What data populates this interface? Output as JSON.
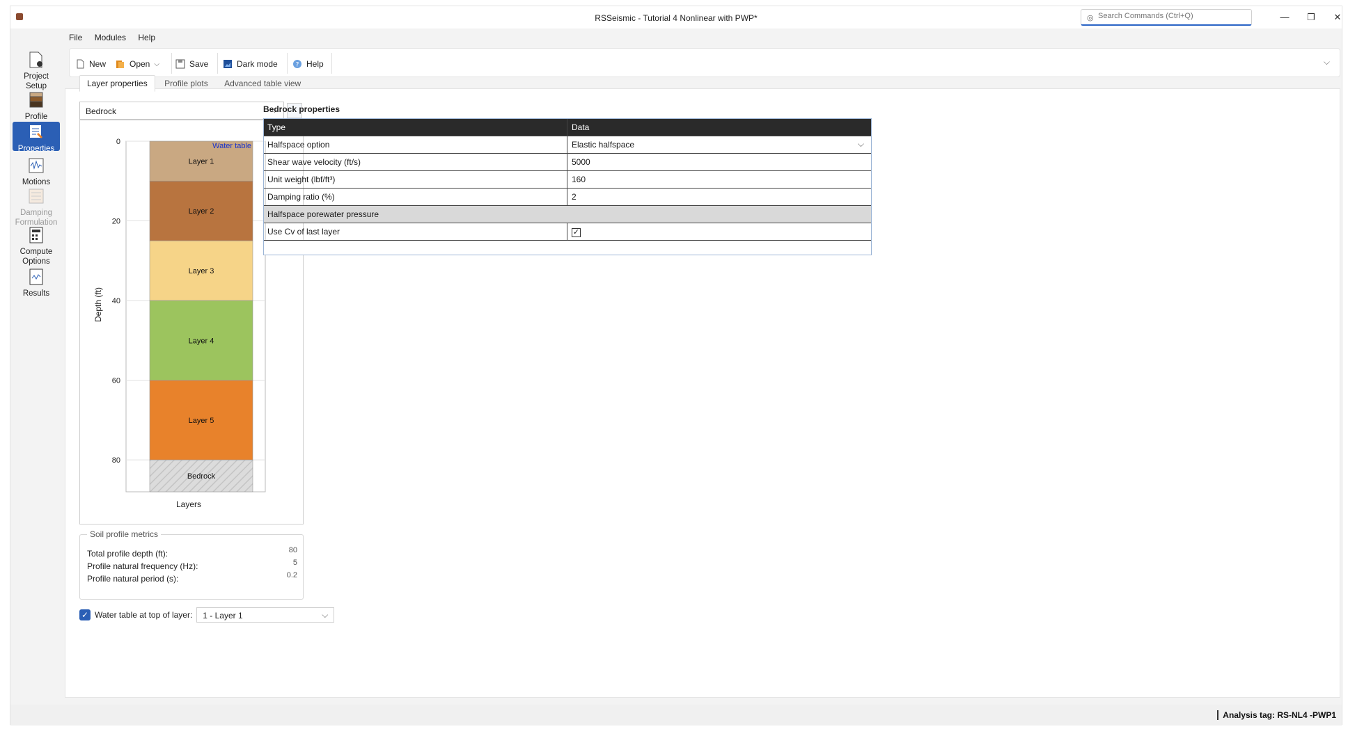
{
  "window": {
    "title": "RSSeismic - Tutorial 4 Nonlinear with PWP*"
  },
  "search": {
    "placeholder": "Search Commands (Ctrl+Q)"
  },
  "menu": {
    "items": [
      "File",
      "Modules",
      "Help"
    ]
  },
  "toolbar": {
    "new": "New",
    "open": "Open",
    "save": "Save",
    "dark_mode": "Dark mode",
    "help": "Help"
  },
  "nav": {
    "project_setup": "Project Setup",
    "profile": "Profile",
    "properties": "Properties",
    "motions": "Motions",
    "damping": "Damping Formulation",
    "compute": "Compute Options",
    "results": "Results"
  },
  "tabs": [
    "Layer properties",
    "Profile plots",
    "Advanced table view"
  ],
  "layer_select": {
    "value": "Bedrock"
  },
  "chart_data": {
    "type": "bar",
    "title": "",
    "xlabel": "Layers",
    "ylabel": "Depth (ft)",
    "yticks": [
      "0",
      "20",
      "40",
      "60",
      "80"
    ],
    "ylim": [
      0,
      88
    ],
    "annotation": "Water table",
    "layers": [
      {
        "name": "Layer 1",
        "top": 0,
        "bottom": 10,
        "color": "#c9a882"
      },
      {
        "name": "Layer 2",
        "top": 10,
        "bottom": 25,
        "color": "#b8743f"
      },
      {
        "name": "Layer 3",
        "top": 25,
        "bottom": 40,
        "color": "#f6d488"
      },
      {
        "name": "Layer 4",
        "top": 40,
        "bottom": 60,
        "color": "#9cc45e"
      },
      {
        "name": "Layer 5",
        "top": 60,
        "bottom": 80,
        "color": "#e8822b"
      },
      {
        "name": "Bedrock",
        "top": 80,
        "bottom": 88,
        "color": "#d9d9d9"
      }
    ]
  },
  "metrics": {
    "legend": "Soil profile metrics",
    "rows": [
      {
        "label": "Total profile depth (ft):",
        "value": "80"
      },
      {
        "label": "Profile natural frequency (Hz):",
        "value": "5"
      },
      {
        "label": "Profile natural period (s):",
        "value": "0.2"
      }
    ]
  },
  "water_table": {
    "label": "Water table at top of layer:",
    "value": "1 - Layer 1"
  },
  "properties": {
    "title": "Bedrock properties",
    "col_type": "Type",
    "col_data": "Data",
    "rows": {
      "halfspace_option": {
        "label": "Halfspace option",
        "value": "Elastic halfspace"
      },
      "shear_wave": {
        "label": "Shear wave velocity (ft/s)",
        "value": "5000"
      },
      "unit_weight": {
        "label": "Unit weight (lbf/ft³)",
        "value": "160"
      },
      "damping": {
        "label": "Damping ratio (%)",
        "value": "2"
      },
      "section": {
        "label": "Halfspace porewater pressure"
      },
      "use_cv": {
        "label": "Use Cv of last layer",
        "value": "✓"
      }
    }
  },
  "status": {
    "analysis_tag": "Analysis tag: RS-NL4 -PWP1"
  }
}
